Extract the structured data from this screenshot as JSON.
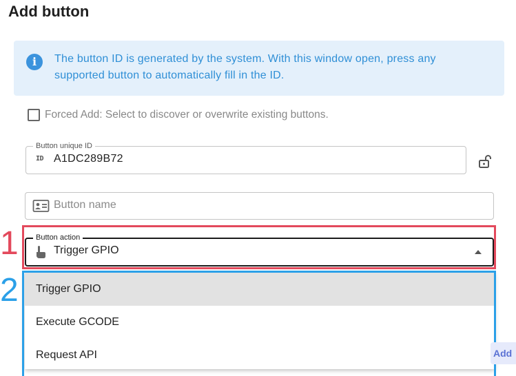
{
  "dialog": {
    "title": "Add button"
  },
  "info": {
    "icon": "info-icon",
    "text": "The button ID is generated by the system. With this window open, press any supported button to automatically fill in the ID."
  },
  "forced_add": {
    "label": "Forced Add: Select to discover or overwrite existing buttons.",
    "checked": false
  },
  "unique_id": {
    "label": "Button unique ID",
    "prefix_icon": "ID",
    "value": "A1DC289B72",
    "lock_icon": "unlock-icon"
  },
  "button_name": {
    "placeholder": "Button name",
    "value": "",
    "icon": "id-card-icon"
  },
  "button_action": {
    "label": "Button action",
    "value": "Trigger GPIO",
    "icon": "hand-pointer-icon"
  },
  "annotations": {
    "marker_1": "1",
    "marker_2": "2",
    "color_1": "#e3495c",
    "color_2": "#2ba0e8"
  },
  "action_menu": {
    "options": [
      {
        "label": "Trigger GPIO",
        "selected": true
      },
      {
        "label": "Execute GCODE",
        "selected": false
      },
      {
        "label": "Request API",
        "selected": false
      }
    ]
  },
  "footer": {
    "add_label": "Add"
  }
}
